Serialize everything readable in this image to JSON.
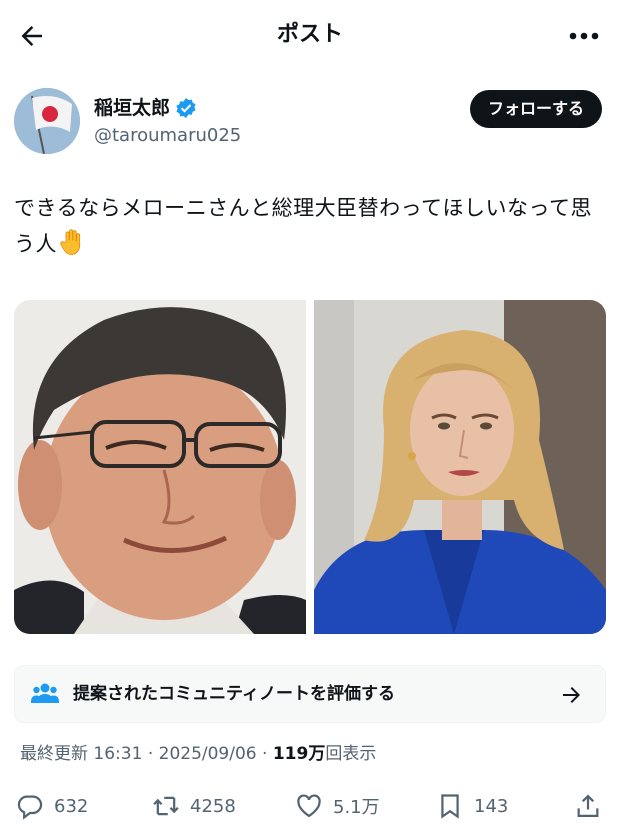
{
  "header": {
    "title": "ポスト"
  },
  "author": {
    "name": "稲垣太郎",
    "handle": "@taroumaru025",
    "follow_label": "フォローする"
  },
  "post": {
    "text": "できるならメローニさんと総理大臣替わってほしいなって思う人",
    "emoji_icon": "raised-hand-icon"
  },
  "community_note": {
    "label": "提案されたコミュニティノートを評価する"
  },
  "meta": {
    "updated_label": "最終更新",
    "time": "16:31",
    "separator": "·",
    "date": "2025/09/06",
    "views_count": "119万",
    "views_label": "回表示"
  },
  "actions": {
    "replies": "632",
    "reposts": "4258",
    "likes": "5.1万",
    "bookmarks": "143"
  },
  "colors": {
    "text": "#0f1419",
    "secondary": "#536471",
    "verified": "#1d9bf0",
    "follow_bg": "#0f1419"
  }
}
